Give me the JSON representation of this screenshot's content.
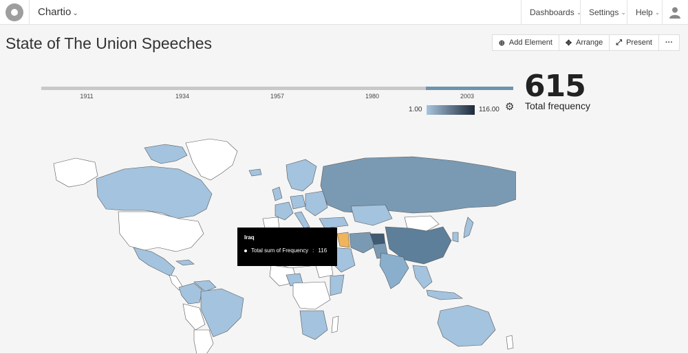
{
  "app": {
    "brand": "Chartio"
  },
  "nav": {
    "dashboards": "Dashboards",
    "settings": "Settings",
    "help": "Help"
  },
  "page": {
    "title": "State of The Union Speeches"
  },
  "toolbar": {
    "add_element": "Add Element",
    "arrange": "Arrange",
    "present": "Present",
    "more": "···"
  },
  "timeline": {
    "ticks": [
      "1911",
      "1934",
      "1957",
      "1980",
      "2003"
    ],
    "selected_range": [
      1991,
      2014
    ]
  },
  "legend": {
    "min": "1.00",
    "max": "116.00",
    "color_low": "#a8c4de",
    "color_high": "#1e2a3a"
  },
  "kpi": {
    "value": "615",
    "label": "Total frequency"
  },
  "tooltip": {
    "country": "Iraq",
    "metric": "Total sum of Frequency",
    "separator": ":",
    "value": "116"
  },
  "colors": {
    "accent": "#6f93ad",
    "highlight": "#f0b45a",
    "no_data": "#ffffff"
  }
}
